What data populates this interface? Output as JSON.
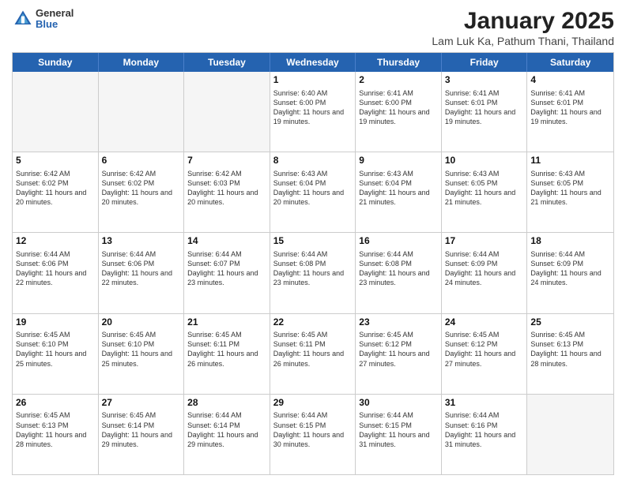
{
  "header": {
    "logo_general": "General",
    "logo_blue": "Blue",
    "month_title": "January 2025",
    "location": "Lam Luk Ka, Pathum Thani, Thailand"
  },
  "days_of_week": [
    "Sunday",
    "Monday",
    "Tuesday",
    "Wednesday",
    "Thursday",
    "Friday",
    "Saturday"
  ],
  "weeks": [
    [
      {
        "day": "",
        "info": ""
      },
      {
        "day": "",
        "info": ""
      },
      {
        "day": "",
        "info": ""
      },
      {
        "day": "1",
        "info": "Sunrise: 6:40 AM\nSunset: 6:00 PM\nDaylight: 11 hours and 19 minutes."
      },
      {
        "day": "2",
        "info": "Sunrise: 6:41 AM\nSunset: 6:00 PM\nDaylight: 11 hours and 19 minutes."
      },
      {
        "day": "3",
        "info": "Sunrise: 6:41 AM\nSunset: 6:01 PM\nDaylight: 11 hours and 19 minutes."
      },
      {
        "day": "4",
        "info": "Sunrise: 6:41 AM\nSunset: 6:01 PM\nDaylight: 11 hours and 19 minutes."
      }
    ],
    [
      {
        "day": "5",
        "info": "Sunrise: 6:42 AM\nSunset: 6:02 PM\nDaylight: 11 hours and 20 minutes."
      },
      {
        "day": "6",
        "info": "Sunrise: 6:42 AM\nSunset: 6:02 PM\nDaylight: 11 hours and 20 minutes."
      },
      {
        "day": "7",
        "info": "Sunrise: 6:42 AM\nSunset: 6:03 PM\nDaylight: 11 hours and 20 minutes."
      },
      {
        "day": "8",
        "info": "Sunrise: 6:43 AM\nSunset: 6:04 PM\nDaylight: 11 hours and 20 minutes."
      },
      {
        "day": "9",
        "info": "Sunrise: 6:43 AM\nSunset: 6:04 PM\nDaylight: 11 hours and 21 minutes."
      },
      {
        "day": "10",
        "info": "Sunrise: 6:43 AM\nSunset: 6:05 PM\nDaylight: 11 hours and 21 minutes."
      },
      {
        "day": "11",
        "info": "Sunrise: 6:43 AM\nSunset: 6:05 PM\nDaylight: 11 hours and 21 minutes."
      }
    ],
    [
      {
        "day": "12",
        "info": "Sunrise: 6:44 AM\nSunset: 6:06 PM\nDaylight: 11 hours and 22 minutes."
      },
      {
        "day": "13",
        "info": "Sunrise: 6:44 AM\nSunset: 6:06 PM\nDaylight: 11 hours and 22 minutes."
      },
      {
        "day": "14",
        "info": "Sunrise: 6:44 AM\nSunset: 6:07 PM\nDaylight: 11 hours and 23 minutes."
      },
      {
        "day": "15",
        "info": "Sunrise: 6:44 AM\nSunset: 6:08 PM\nDaylight: 11 hours and 23 minutes."
      },
      {
        "day": "16",
        "info": "Sunrise: 6:44 AM\nSunset: 6:08 PM\nDaylight: 11 hours and 23 minutes."
      },
      {
        "day": "17",
        "info": "Sunrise: 6:44 AM\nSunset: 6:09 PM\nDaylight: 11 hours and 24 minutes."
      },
      {
        "day": "18",
        "info": "Sunrise: 6:44 AM\nSunset: 6:09 PM\nDaylight: 11 hours and 24 minutes."
      }
    ],
    [
      {
        "day": "19",
        "info": "Sunrise: 6:45 AM\nSunset: 6:10 PM\nDaylight: 11 hours and 25 minutes."
      },
      {
        "day": "20",
        "info": "Sunrise: 6:45 AM\nSunset: 6:10 PM\nDaylight: 11 hours and 25 minutes."
      },
      {
        "day": "21",
        "info": "Sunrise: 6:45 AM\nSunset: 6:11 PM\nDaylight: 11 hours and 26 minutes."
      },
      {
        "day": "22",
        "info": "Sunrise: 6:45 AM\nSunset: 6:11 PM\nDaylight: 11 hours and 26 minutes."
      },
      {
        "day": "23",
        "info": "Sunrise: 6:45 AM\nSunset: 6:12 PM\nDaylight: 11 hours and 27 minutes."
      },
      {
        "day": "24",
        "info": "Sunrise: 6:45 AM\nSunset: 6:12 PM\nDaylight: 11 hours and 27 minutes."
      },
      {
        "day": "25",
        "info": "Sunrise: 6:45 AM\nSunset: 6:13 PM\nDaylight: 11 hours and 28 minutes."
      }
    ],
    [
      {
        "day": "26",
        "info": "Sunrise: 6:45 AM\nSunset: 6:13 PM\nDaylight: 11 hours and 28 minutes."
      },
      {
        "day": "27",
        "info": "Sunrise: 6:45 AM\nSunset: 6:14 PM\nDaylight: 11 hours and 29 minutes."
      },
      {
        "day": "28",
        "info": "Sunrise: 6:44 AM\nSunset: 6:14 PM\nDaylight: 11 hours and 29 minutes."
      },
      {
        "day": "29",
        "info": "Sunrise: 6:44 AM\nSunset: 6:15 PM\nDaylight: 11 hours and 30 minutes."
      },
      {
        "day": "30",
        "info": "Sunrise: 6:44 AM\nSunset: 6:15 PM\nDaylight: 11 hours and 31 minutes."
      },
      {
        "day": "31",
        "info": "Sunrise: 6:44 AM\nSunset: 6:16 PM\nDaylight: 11 hours and 31 minutes."
      },
      {
        "day": "",
        "info": ""
      }
    ]
  ]
}
